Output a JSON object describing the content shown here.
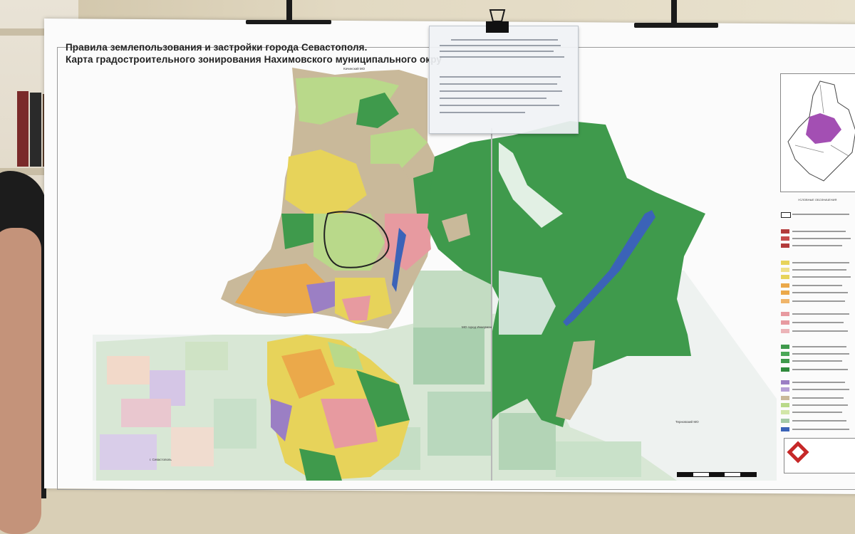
{
  "map": {
    "title_line1": "Правила землепользования и застройки города Севастополя.",
    "title_line2": "Карта градостроительного зонирования Нахимовского муниципального окру",
    "place_labels": {
      "north_top": "Качинский МО",
      "center_right": "МО город Инкерман",
      "bottom_left": "г. Севастополь",
      "east_edge": "Терновский МО"
    },
    "legend_heading": "УСЛОВНЫЕ ОБОЗНАЧЕНИЯ",
    "colors": {
      "urban_yellow": "#e7d35a",
      "residential_orange": "#eba94a",
      "forest_green": "#3f9a4c",
      "light_green": "#b9d98a",
      "agri_tan": "#c9b99a",
      "water_blue": "#3b63b8",
      "commercial_pink": "#e79aa0",
      "purple_zone": "#9b7fc4",
      "district_purple": "#a34fb3"
    }
  }
}
